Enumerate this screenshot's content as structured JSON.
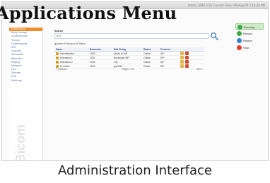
{
  "title_overlay": "Applications Menu",
  "caption": "Administration Interface",
  "topbar_text": "Admin | PBX 5.9 | Current Time: 09-Aug-09 5:15:34 PM",
  "sidebar": {
    "items": [
      {
        "label": "Extensions",
        "active": true
      },
      {
        "label": "Ring Groups",
        "active": false
      },
      {
        "label": "Conferences",
        "active": false
      },
      {
        "label": "Trunks",
        "active": false
      },
      {
        "label": "Conferences",
        "active": false
      },
      {
        "label": "IVR",
        "active": false
      },
      {
        "label": "Queues",
        "active": false
      },
      {
        "label": "Voicemail",
        "active": false
      },
      {
        "label": "Recorder",
        "active": false
      },
      {
        "label": "Paging",
        "active": false
      },
      {
        "label": "Network",
        "active": false
      },
      {
        "label": "Fax",
        "active": false
      },
      {
        "label": "System",
        "active": false
      },
      {
        "label": "LCR",
        "active": false
      },
      {
        "label": "Settings",
        "active": false
      }
    ],
    "brand": "Bicom"
  },
  "search": {
    "label": "Search",
    "placeholder": "",
    "value": "Ext",
    "filter_text": "Name  Extension  All  Status"
  },
  "grid": {
    "headers": [
      "Name",
      "Extension",
      "Dial String",
      "Status",
      "Protocol",
      ""
    ],
    "rows": [
      {
        "name": "Administrator",
        "extension": "1000",
        "dial": "Dialer to SIP",
        "status": "Online",
        "protocol": "SIP"
      },
      {
        "name": "Extension 1",
        "extension": "1001",
        "dial": "Broadcast SIP",
        "status": "Online",
        "protocol": "SIP"
      },
      {
        "name": "Extension 2",
        "extension": "1002",
        "dial": "Fax",
        "status": "Online",
        "protocol": "SIP"
      },
      {
        "name": "Dr Admin",
        "extension": "1003",
        "dial": "gw/1/99",
        "status": "Online",
        "protocol": "SIP"
      }
    ],
    "pager": {
      "prev": "« previous",
      "info": "Page 1 of 1",
      "next": "next »"
    }
  },
  "actions": [
    {
      "label": "Running",
      "icon": "running-icon",
      "highlight": true
    },
    {
      "label": "Reload",
      "icon": "reload-icon",
      "highlight": false
    },
    {
      "label": "Restart",
      "icon": "restart-icon",
      "highlight": false
    },
    {
      "label": "Stop",
      "icon": "stop-icon",
      "highlight": false
    }
  ],
  "colors": {
    "sidebar_active": "#f08c2a",
    "link": "#4a6ca6",
    "status_green": "#3ea84a",
    "action_stop": "#e0412c"
  }
}
